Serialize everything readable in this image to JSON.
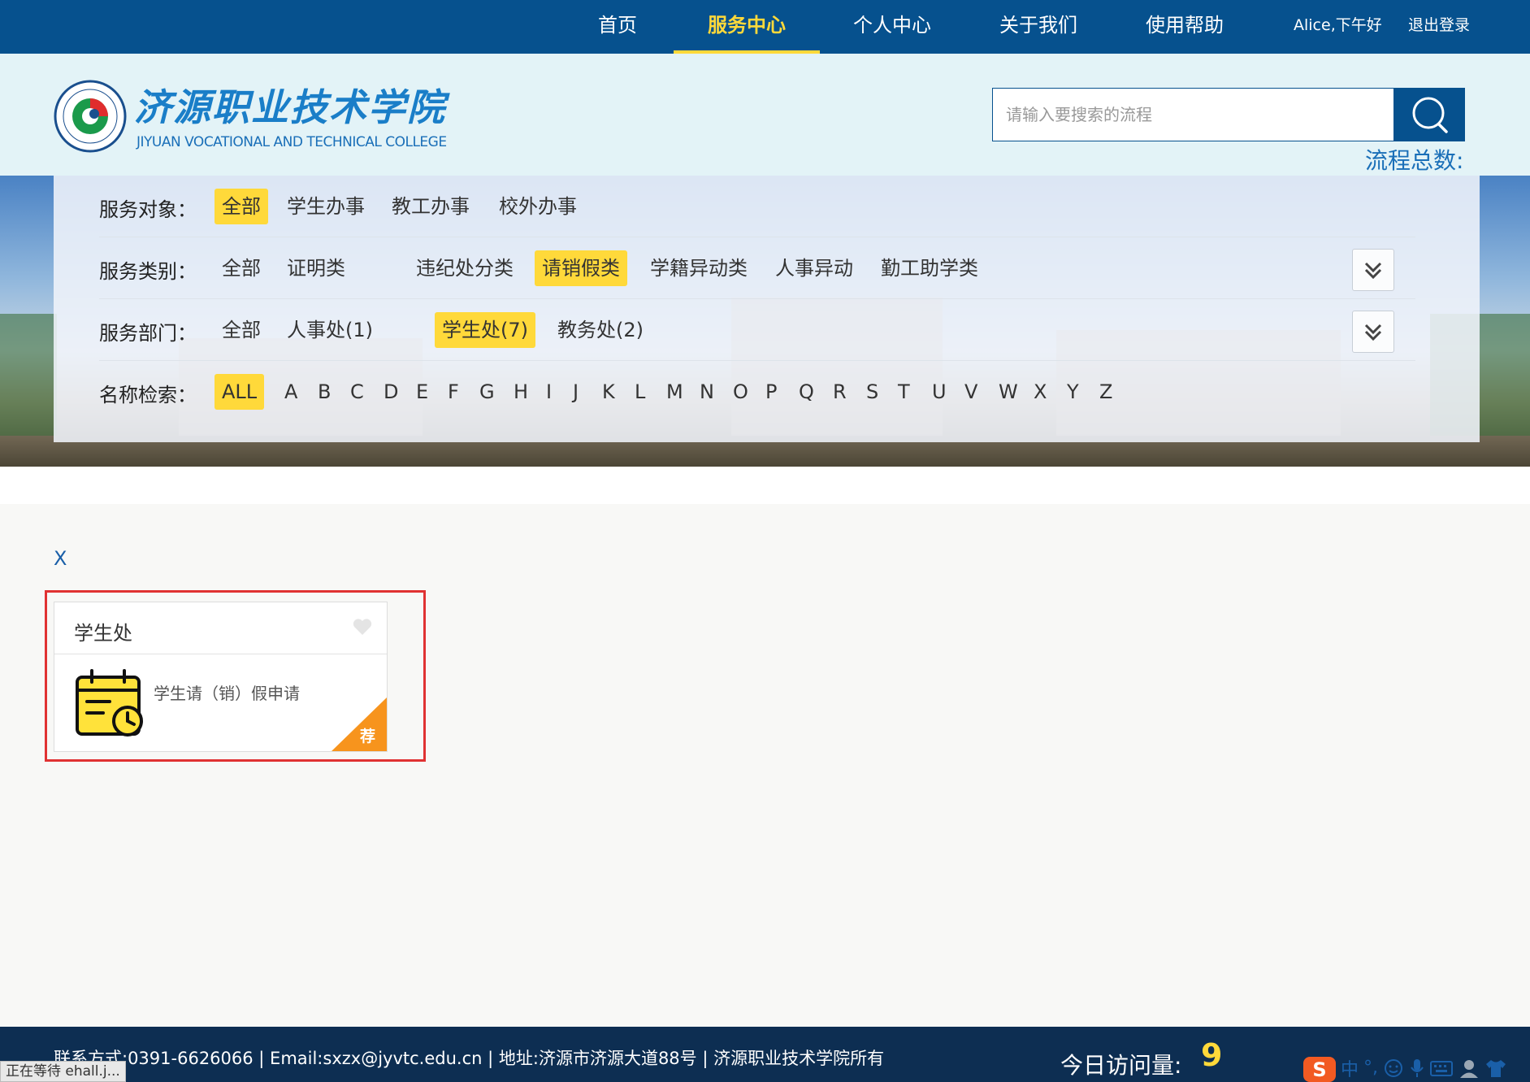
{
  "nav": {
    "items": [
      {
        "label": "首页",
        "active": false
      },
      {
        "label": "服务中心",
        "active": true
      },
      {
        "label": "个人中心",
        "active": false
      },
      {
        "label": "关于我们",
        "active": false
      },
      {
        "label": "使用帮助",
        "active": false
      }
    ],
    "greeting": "Alice,下午好",
    "logout": "退出登录"
  },
  "header": {
    "logo_cn": "济源职业技术学院",
    "logo_en": "JIYUAN VOCATIONAL AND TECHNICAL COLLEGE",
    "search_placeholder": "请输入要搜索的流程",
    "flow_total_label": "流程总数:"
  },
  "filters": {
    "target": {
      "label": "服务对象：",
      "options": [
        "全部",
        "学生办事",
        "教工办事",
        "校外办事"
      ],
      "selected": "全部"
    },
    "category": {
      "label": "服务类别：",
      "options": [
        "全部",
        "证明类",
        "违纪处分类",
        "请销假类",
        "学籍异动类",
        "人事异动",
        "勤工助学类"
      ],
      "selected": "请销假类"
    },
    "department": {
      "label": "服务部门：",
      "options": [
        "全部",
        "人事处(1)",
        "学生处(7)",
        "教务处(2)"
      ],
      "selected": "学生处(7)"
    },
    "name": {
      "label": "名称检索：",
      "options": [
        "ALL",
        "A",
        "B",
        "C",
        "D",
        "E",
        "F",
        "G",
        "H",
        "I",
        "J",
        "K",
        "L",
        "M",
        "N",
        "O",
        "P",
        "Q",
        "R",
        "S",
        "T",
        "U",
        "V",
        "W",
        "X",
        "Y",
        "Z"
      ],
      "selected": "ALL"
    }
  },
  "results": {
    "close_label": "X",
    "card": {
      "title": "学生处",
      "item": "学生请（销）假申请",
      "badge": "荐"
    }
  },
  "footer": {
    "contact": "联系方式:0391-6626066 | Email:sxzx@jyvtc.edu.cn | 地址:济源市济源大道88号 | 济源职业技术学院所有",
    "visits_label": "今日访问量:",
    "visits_value": "9"
  },
  "status_bar": "正在等待 ehall.j...",
  "ime": {
    "lang": "中",
    "punct": "°,"
  },
  "colors": {
    "nav_bg": "#06518e",
    "accent": "#ffd93a",
    "footer_bg": "#0d2e52",
    "highlight": "#e03232",
    "ribbon": "#f7941d"
  }
}
